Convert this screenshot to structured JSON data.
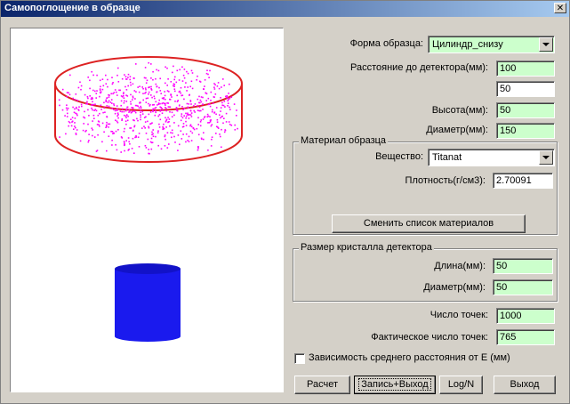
{
  "window": {
    "title": "Самопоглощение в образце",
    "close_glyph": "✕"
  },
  "colors": {
    "sample_cylinder": "#dd2222",
    "points": "#ff00ff",
    "detector": "#1a1aee",
    "input_bg": "#ccffcc"
  },
  "form": {
    "shape_label": "Форма образца:",
    "shape_value": "Цилиндр_снизу",
    "distance_label": "Расстояние до детектора(мм):",
    "distance_value": "100",
    "extra_value": "50",
    "height_label": "Высота(мм):",
    "height_value": "50",
    "diameter_label": "Диаметр(мм):",
    "diameter_value": "150"
  },
  "material": {
    "group_title": "Материал образца",
    "substance_label": "Вещество:",
    "substance_value": "Titanat",
    "density_label": "Плотность(г/см3):",
    "density_value": "2.70091",
    "change_button": "Сменить список материалов"
  },
  "crystal": {
    "group_title": "Размер кристалла детектора",
    "length_label": "Длина(мм):",
    "length_value": "50",
    "diameter_label": "Диаметр(мм):",
    "diameter_value": "50"
  },
  "points": {
    "count_label": "Число точек:",
    "count_value": "1000",
    "actual_label": "Фактическое число точек:",
    "actual_value": "765"
  },
  "dependency_checkbox": {
    "label": "Зависимость среднего расстояния от E (мм)",
    "checked": false
  },
  "buttons": {
    "calc": "Расчет",
    "save_exit": "Запись+Выход",
    "log": "Log/N",
    "exit": "Выход"
  }
}
